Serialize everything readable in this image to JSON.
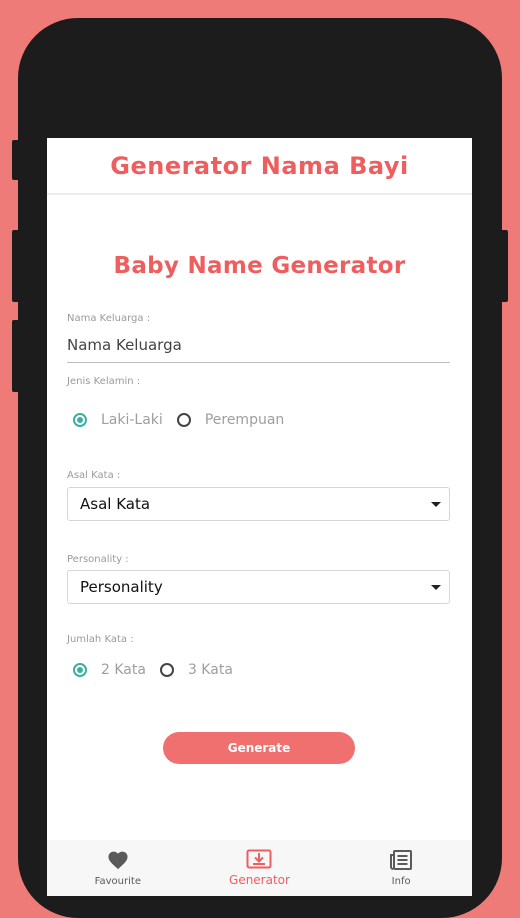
{
  "colors": {
    "background": "#EE7B78",
    "accent": "#EF5E5E",
    "button": "#F07070",
    "radio_selected": "#3bb0a1"
  },
  "app_bar": {
    "title": "Generator Nama Bayi"
  },
  "heading": "Baby Name Generator",
  "family_name": {
    "label": "Nama Keluarga :",
    "placeholder": "Nama Keluarga",
    "value": ""
  },
  "gender": {
    "label": "Jenis Kelamin :",
    "options": [
      {
        "label": "Laki-Laki",
        "selected": true
      },
      {
        "label": "Perempuan",
        "selected": false
      }
    ]
  },
  "origin": {
    "label": "Asal Kata :",
    "selected": "Asal Kata"
  },
  "personality": {
    "label": "Personality :",
    "selected": "Personality"
  },
  "word_count": {
    "label": "Jumlah Kata :",
    "options": [
      {
        "label": "2 Kata",
        "selected": true
      },
      {
        "label": "3 Kata",
        "selected": false
      }
    ]
  },
  "generate_button": {
    "label": "Generate"
  },
  "bottom_nav": {
    "items": [
      {
        "label": "Favourite",
        "icon": "heart-icon",
        "active": false
      },
      {
        "label": "Generator",
        "icon": "download-box-icon",
        "active": true
      },
      {
        "label": "Info",
        "icon": "news-icon",
        "active": false
      }
    ]
  }
}
